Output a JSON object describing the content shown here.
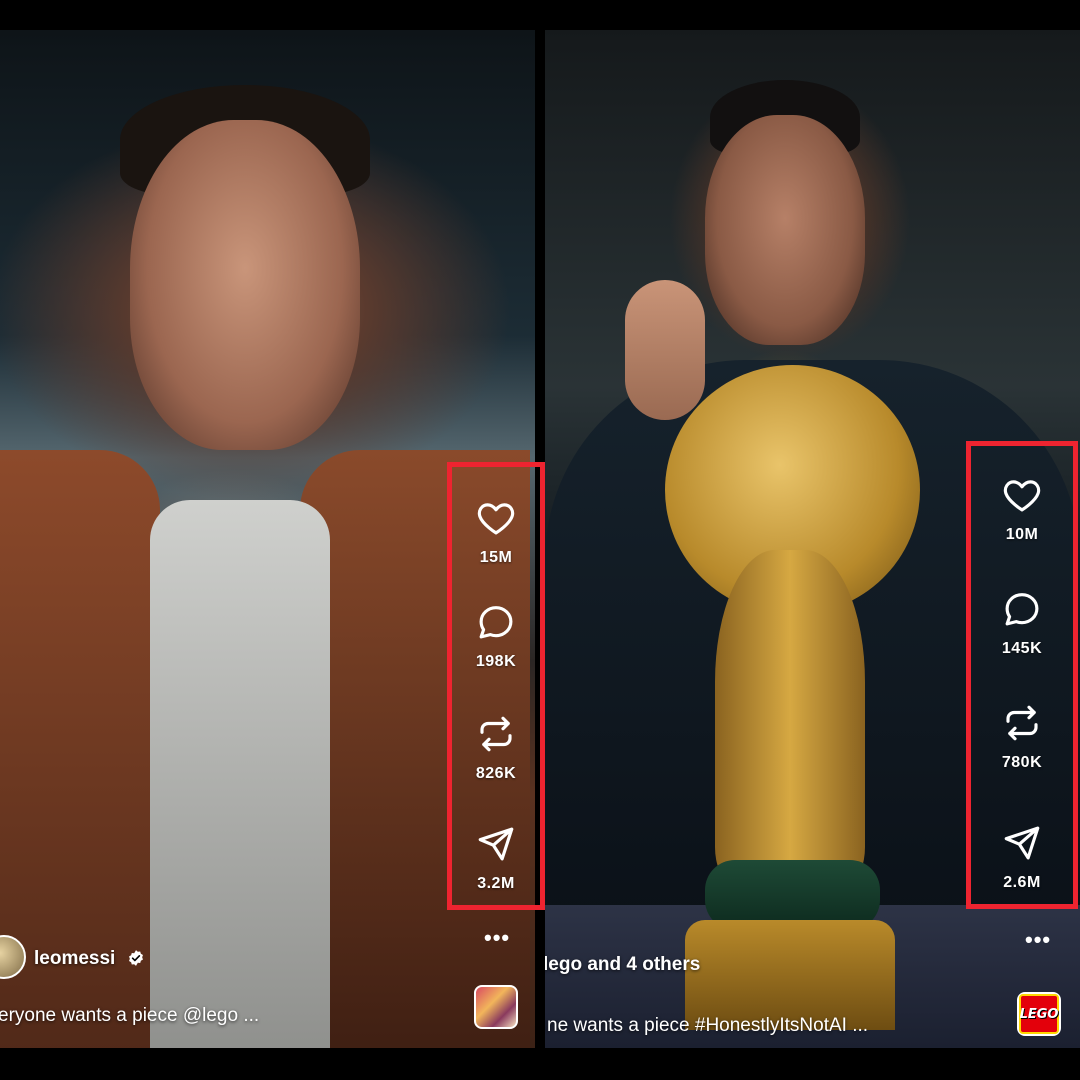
{
  "left_post": {
    "username": "leomessi",
    "verified": true,
    "caption": "eryone wants a piece @lego ...",
    "more_label": "•••",
    "actions": {
      "likes": "15M",
      "comments": "198K",
      "reposts": "826K",
      "shares": "3.2M"
    }
  },
  "right_post": {
    "username": "lego",
    "collab_suffix": "and 4 others",
    "caption": "ne wants a piece #HonestlyItsNotAI ...",
    "more_label": "•••",
    "audio_logo_text": "LEGO",
    "actions": {
      "likes": "10M",
      "comments": "145K",
      "reposts": "780K",
      "shares": "2.6M"
    }
  },
  "colors": {
    "highlight_border": "#ee2430",
    "text": "#ffffff",
    "lego_red": "#e3000b",
    "lego_yellow": "#ffd700"
  },
  "icons": [
    "heart-icon",
    "comment-bubble-icon",
    "repost-icon",
    "send-paper-plane-icon",
    "more-dots-icon",
    "verified-badge-icon"
  ]
}
